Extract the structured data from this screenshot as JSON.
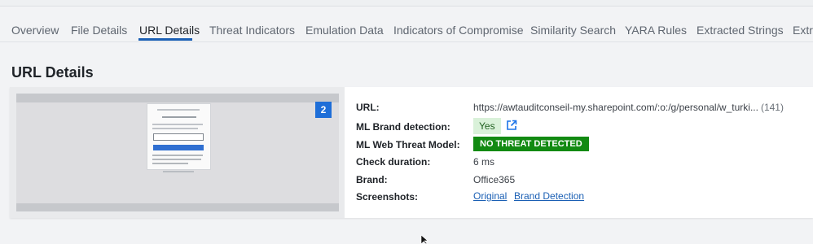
{
  "tabs": [
    {
      "label": "Overview",
      "active": false
    },
    {
      "label": "File Details",
      "active": false
    },
    {
      "label": "URL Details",
      "active": true
    },
    {
      "label": "Threat Indicators",
      "active": false
    },
    {
      "label": "Emulation Data",
      "active": false
    },
    {
      "label": "Indicators of Compromise",
      "active": false
    },
    {
      "label": "Similarity Search",
      "active": false
    },
    {
      "label": "YARA Rules",
      "active": false
    },
    {
      "label": "Extracted Strings",
      "active": false
    },
    {
      "label": "Extra",
      "active": false
    }
  ],
  "section_title": "URL Details",
  "screenshot_preview": {
    "badge_count": "2"
  },
  "details": {
    "url": {
      "label": "URL:",
      "value": "https://awtauditconseil-my.sharepoint.com/:o:/g/personal/w_turki...",
      "count": "(141)"
    },
    "brand_detection": {
      "label": "ML Brand detection:",
      "value": "Yes"
    },
    "web_threat_model": {
      "label": "ML Web Threat Model:",
      "value": "NO THREAT DETECTED"
    },
    "check_duration": {
      "label": "Check duration:",
      "value": "6 ms"
    },
    "brand": {
      "label": "Brand:",
      "value": "Office365"
    },
    "screenshots": {
      "label": "Screenshots:",
      "links": [
        "Original",
        "Brand Detection"
      ]
    }
  },
  "colors": {
    "accent": "#1a5fb4",
    "badge": "#1e6ed8",
    "success_pill": "#d9f1d9",
    "no_threat": "#128a12"
  },
  "icons": {
    "external_link": "external-link-icon",
    "cursor": "mouse-cursor-icon"
  }
}
